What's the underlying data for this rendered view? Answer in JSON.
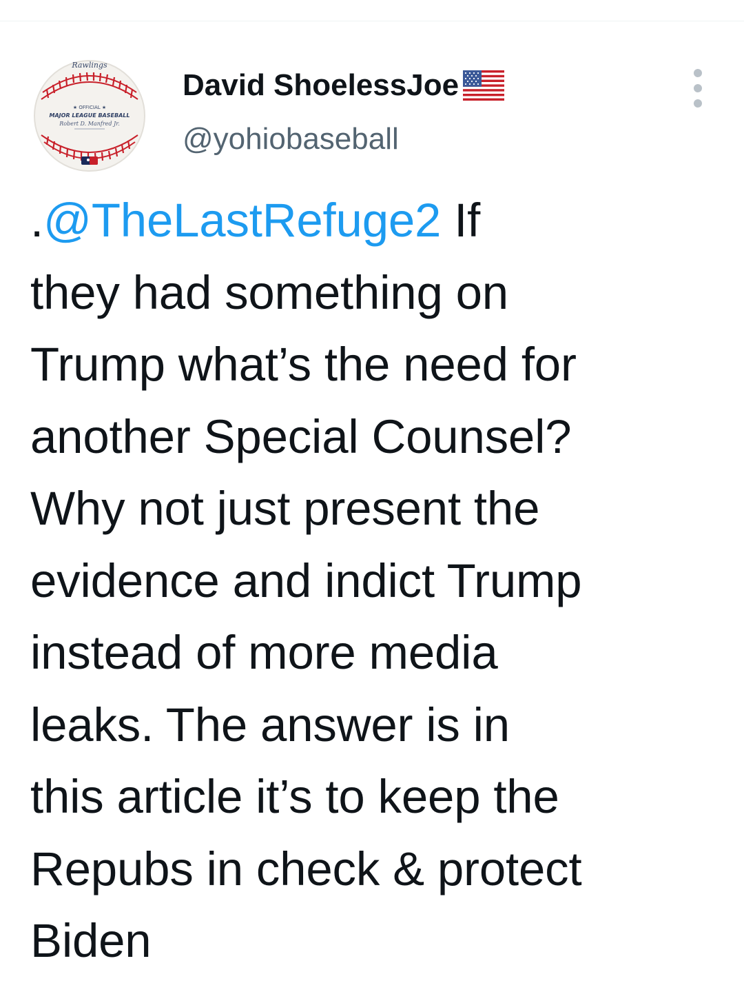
{
  "tweet": {
    "author": {
      "display_name": "David ShoelessJoe",
      "flag_icon": "us-flag-icon",
      "handle": "@yohiobaseball",
      "avatar_icon": "baseball-avatar-icon",
      "avatar_text": {
        "brand": "Rawlings",
        "line1": "★ OFFICIAL ★",
        "line2": "MAJOR LEAGUE BASEBALL",
        "signature": "Robert D. Manfred Jr."
      }
    },
    "more_icon": "more-options-icon",
    "text_prefix": ".",
    "mention": "@TheLastRefuge2",
    "text_lines": [
      " If",
      "they had something on",
      "Trump what’s the need for",
      "another Special Counsel?",
      "Why not just present the",
      "evidence and indict Trump",
      "instead of more media",
      "leaks. The answer is in",
      "this article it’s to keep the",
      "Repubs in check & protect",
      "Biden"
    ]
  },
  "colors": {
    "text": "#0f1419",
    "secondary_text": "#536471",
    "link": "#1d9bf0",
    "stitch_red": "#c8202a"
  }
}
